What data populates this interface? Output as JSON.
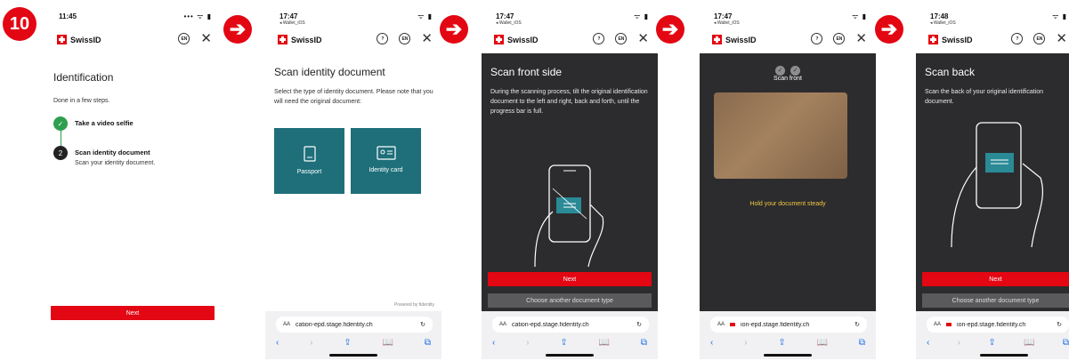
{
  "step_number": "10",
  "arrow_glyph": "➔",
  "brand": "SwissID",
  "lang_badge": "EN",
  "help_glyph": "?",
  "close_glyph": "✕",
  "check_glyph": "✓",
  "screens": [
    {
      "time": "11:45",
      "signal": "••• ᯤ ▮",
      "title": "Identification",
      "intro": "Done in a few steps.",
      "steps": [
        {
          "title": "Take a video selfie",
          "subtitle": "",
          "status": "done"
        },
        {
          "number": "2",
          "title": "Scan identity document",
          "subtitle": "Scan your identity document.",
          "status": "current"
        }
      ],
      "next_label": "Next"
    },
    {
      "time": "17:47",
      "back_app": "◂ Wallet_iOS",
      "signal": "ᯤ ▮",
      "title": "Scan identity document",
      "body": "Select the type of identity document. Please note that you will need the original document:",
      "options": [
        {
          "label": "Passport",
          "icon": "passport-icon"
        },
        {
          "label": "Identity card",
          "icon": "id-card-icon"
        }
      ],
      "powered_by": "Powered by fidentity",
      "url": "cation-epd.stage.fidentity.ch"
    },
    {
      "time": "17:47",
      "back_app": "◂ Wallet_iOS",
      "signal": "ᯤ ▮",
      "title": "Scan front side",
      "body": "During the scanning process, tilt the original identification document to the left and right, back and forth, until the progress bar is full.",
      "next_label": "Next",
      "secondary_label": "Choose another document type",
      "url": "cation-epd.stage.fidentity.ch"
    },
    {
      "time": "17:47",
      "back_app": "◂ Wallet_iOS",
      "signal": "ᯤ ▮",
      "label": "Scan front",
      "hint": "Hold your document steady",
      "url": "ion-epd.stage.fidentity.ch"
    },
    {
      "time": "17:48",
      "back_app": "◂ Wallet_iOS",
      "signal": "ᯤ ▮",
      "title": "Scan back",
      "body": "Scan the back of your original identification document.",
      "next_label": "Next",
      "secondary_label": "Choose another document type",
      "url": "ion-epd.stage.fidentity.ch"
    }
  ],
  "browser": {
    "aa": "AA",
    "lock": "🔒",
    "reload": "↻",
    "back": "‹",
    "forward": "›",
    "share": "⇪",
    "bookmarks": "📖",
    "tabs": "⧉"
  },
  "colors": {
    "accent_red": "#e30613",
    "teal": "#1e6f7a",
    "success_green": "#2e9e4f",
    "dark_bg": "#2c2c2e",
    "hint_yellow": "#f0c541"
  }
}
